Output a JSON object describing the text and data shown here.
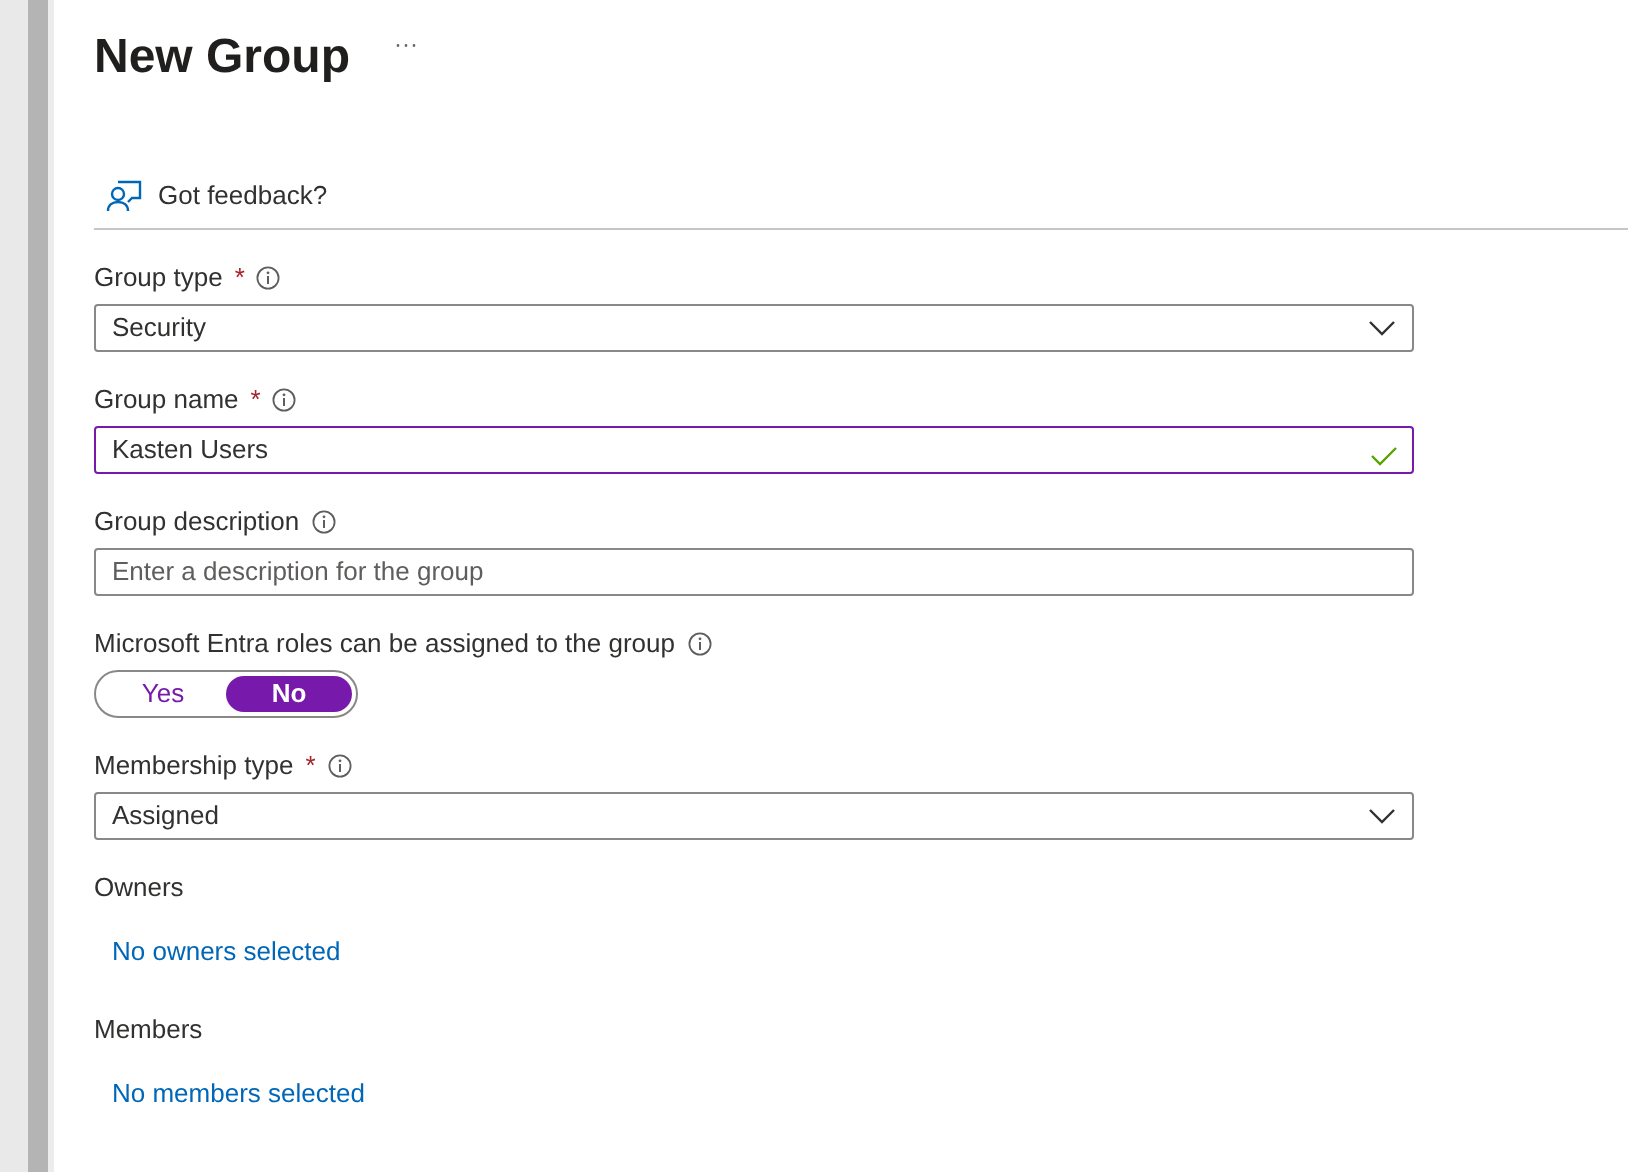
{
  "title": "New Group",
  "more": "···",
  "feedback": "Got feedback?",
  "fields": [
    {
      "kind": "select",
      "label": "Group type",
      "required_mark": "*",
      "info": true,
      "value": "Security"
    },
    {
      "kind": "text",
      "label": "Group name",
      "required_mark": "*",
      "info": true,
      "value": "Kasten Users",
      "focused": true,
      "valid": true
    },
    {
      "kind": "text",
      "label": "Group description",
      "info": true,
      "placeholder": "Enter a description for the group",
      "focused": false,
      "valid": false
    },
    {
      "kind": "toggle",
      "label": "Microsoft Entra roles can be assigned to the group",
      "info": true,
      "options": [
        {
          "label": "Yes",
          "selected": false
        },
        {
          "label": "No",
          "selected": true
        }
      ]
    },
    {
      "kind": "select",
      "label": "Membership type",
      "required_mark": "*",
      "info": true,
      "value": "Assigned"
    },
    {
      "kind": "link",
      "label": "Owners",
      "info": false,
      "link": "No owners selected"
    },
    {
      "kind": "link",
      "label": "Members",
      "info": false,
      "link": "No members selected"
    }
  ]
}
